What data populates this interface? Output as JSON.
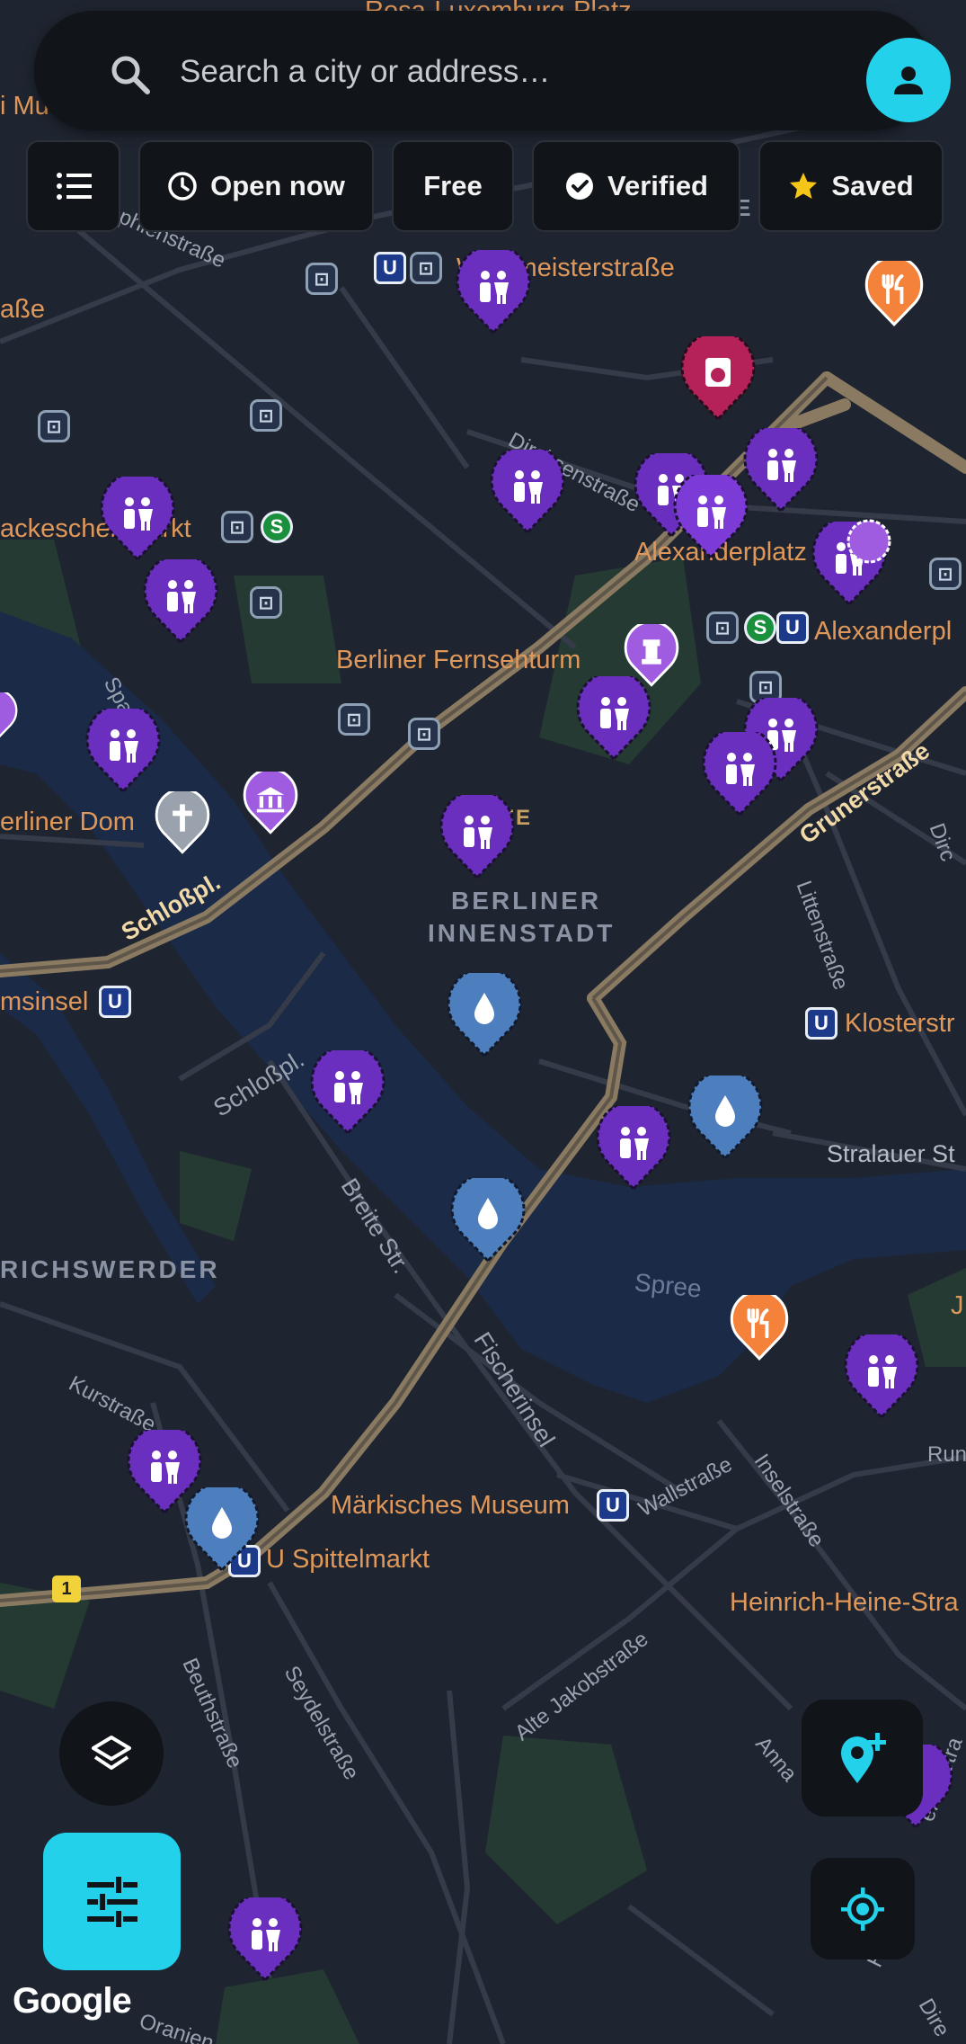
{
  "search": {
    "placeholder": "Search a city or address…"
  },
  "chips": {
    "list_icon": "list-icon",
    "open_now": "Open now",
    "free": "Free",
    "verified": "Verified",
    "saved": "Saved"
  },
  "map": {
    "poi_labels": {
      "rosa": "Rosa-Luxemburg-Platz",
      "weinmeister": "Weinmeisterstraße",
      "hackescher": "ackescher Markt",
      "alexanderplatz": "Alexanderplatz",
      "alexanderpl_station": "Alexanderpl",
      "fernsehturm": "Berliner Fernsehturm",
      "dom": "erliner Dom",
      "museumsinsel": "msinsel",
      "kloster": "Klosterstr",
      "maerkisches": "Märkisches Museum",
      "spittelmarkt": "U Spittelmarkt",
      "heinrich": "Heinrich-Heine-Stra",
      "left_edge_1": "i Mu",
      "left_edge_2": "aße",
      "right_edge": "J"
    },
    "district_labels": {
      "mitte": "MITTE",
      "innenstadt_1": "BERLINER",
      "innenstadt_2": "INNENSTADT",
      "werder": "RICHSWERDER"
    },
    "street_labels": {
      "sophien": "phienstraße",
      "dircksen": "Dircksenstraße",
      "spandauer": "Spa",
      "littenstr": "Littenstraße",
      "schlosspl_2": "Schloßpl.",
      "breite": "Breite Str.",
      "fischerinsel": "Fischerinsel",
      "wallstr": "Wallstraße",
      "inselstr": "Inselstraße",
      "kurstr": "Kurstraße",
      "beuthstr": "Beuthstraße",
      "seydelstr": "Seydelstraße",
      "alte_jakob": "Alte Jakobstraße",
      "anna": "Anna",
      "heine": "eine-Stra",
      "run": "Run",
      "dire": "Dire",
      "orani": "Oranien",
      "stralauer": "Stralauer St",
      "heinr_bottom": "Hei",
      "neue_fr": "ENE",
      "dirk_right": "Dirc"
    },
    "road_labels": {
      "schlosspl": "Schloßpl.",
      "gruner": "Grunerstraße"
    },
    "water_labels": {
      "spree": "Spree"
    },
    "route_badge": "1",
    "transit_badges": {
      "ubahn": "U",
      "sbahn": "S"
    },
    "pin_icons": {
      "toilet": "toilet-icon",
      "water": "water-drop-icon",
      "restaurant": "restaurant-icon",
      "laundry": "laundry-icon",
      "museum": "museum-icon",
      "church": "church-icon",
      "tower": "tower-icon"
    },
    "colors": {
      "toilet_pin": "#6a2fbf",
      "water_pin": "#4d7fbf",
      "restaurant_pin": "#f5823a",
      "laundry_pin": "#b5225a",
      "museum_pin": "#a05ce0",
      "church_pin": "#9aa3ad",
      "accent": "#23d1ea",
      "panel": "#111419"
    }
  },
  "controls": {
    "layers_icon": "layers-icon",
    "filter_icon": "filter-sliders-icon",
    "add_place_icon": "add-location-icon",
    "locate_icon": "my-location-icon"
  },
  "attribution": "Google"
}
